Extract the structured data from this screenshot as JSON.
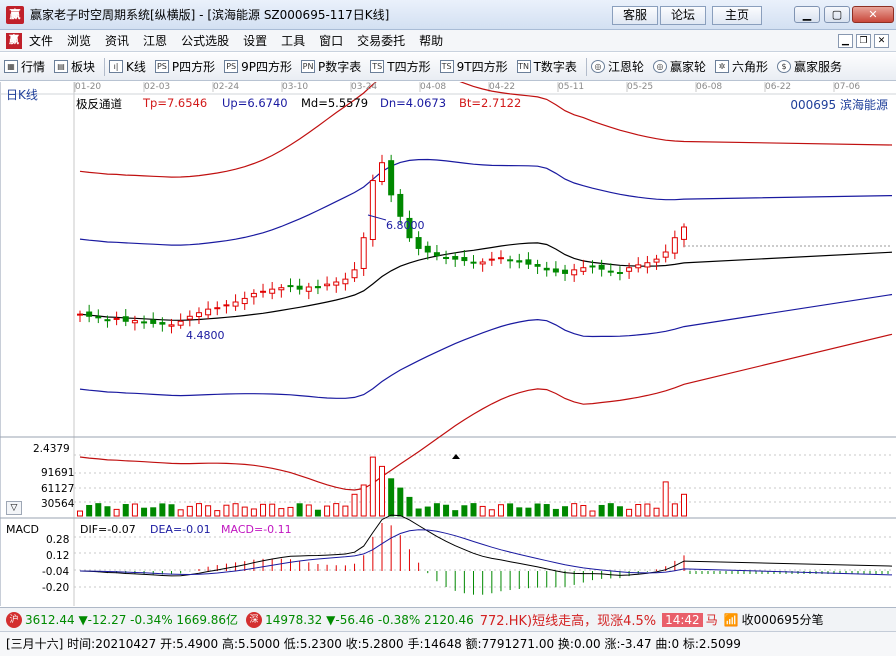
{
  "window": {
    "logo": "赢",
    "title": "赢家老子时空周期系统[纵横版] - [滨海能源  SZ000695-117日K线]",
    "buttons": [
      "客服",
      "论坛",
      "主页"
    ]
  },
  "menubar": {
    "logo": "赢",
    "items": [
      "文件",
      "浏览",
      "资讯",
      "江恩",
      "公式选股",
      "设置",
      "工具",
      "窗口",
      "交易委托",
      "帮助"
    ]
  },
  "toolbar": {
    "items": [
      {
        "icon": "grid-icon",
        "glyph": "▦",
        "label": "行情"
      },
      {
        "icon": "blocks-icon",
        "glyph": "▤",
        "label": "板块"
      },
      {
        "icon": "candlestick-icon",
        "glyph": "ı|",
        "label": "K线"
      },
      {
        "icon": "ps-icon",
        "glyph": "PS",
        "label": "P四方形"
      },
      {
        "icon": "9p-icon",
        "glyph": "PS",
        "label": "9P四方形"
      },
      {
        "icon": "pn-icon",
        "glyph": "PN",
        "label": "P数字表"
      },
      {
        "icon": "ts-icon",
        "glyph": "TS",
        "label": "T四方形"
      },
      {
        "icon": "9t-icon",
        "glyph": "TS",
        "label": "9T四方形"
      },
      {
        "icon": "tn-icon",
        "glyph": "TN",
        "label": "T数字表"
      },
      {
        "icon": "gann-wheel-icon",
        "glyph": "◎",
        "label": "江恩轮"
      },
      {
        "icon": "winner-wheel-icon",
        "glyph": "◎",
        "label": "赢家轮"
      },
      {
        "icon": "hexagon-icon",
        "glyph": "✲",
        "label": "六角形"
      },
      {
        "icon": "dollar-icon",
        "glyph": "$",
        "label": "赢家服务"
      }
    ]
  },
  "chart": {
    "period": "日K线",
    "dates": [
      "01-20",
      "02-03",
      "02-24",
      "03-10",
      "03-24",
      "04-08",
      "04-22",
      "05-11",
      "05-25",
      "06-08",
      "06-22",
      "07-06"
    ],
    "indicator": "极反通道",
    "tp": "Tp=7.6546",
    "up": "Up=6.6740",
    "md": "Md=5.5579",
    "dn": "Dn=4.0673",
    "bt": "Bt=2.7122",
    "stock": "000695  滨海能源",
    "high_label": "6.8000",
    "low_label": "4.4800",
    "volume_scale": [
      "2.4379",
      "91691",
      "61127",
      "30564"
    ],
    "macd": {
      "name": "MACD",
      "dif": "DIF=-0.07",
      "dea": "DEA=-0.01",
      "macd": "MACD=-0.11",
      "scale": [
        "0.28",
        "0.12",
        "-0.04",
        "-0.20"
      ]
    },
    "colors": {
      "up": "#e00000",
      "down": "#008800",
      "upper_band": "#c01010",
      "mid_band": "#1a1aa0",
      "middle": "#000000"
    }
  },
  "chart_data": {
    "type": "candlestick",
    "indicator": "极反通道",
    "close": [
      4.63,
      4.6,
      4.58,
      4.55,
      4.57,
      4.53,
      4.54,
      4.52,
      4.5,
      4.49,
      4.48,
      4.53,
      4.6,
      4.65,
      4.7,
      4.72,
      4.76,
      4.8,
      4.85,
      4.92,
      4.95,
      4.98,
      5.0,
      5.02,
      4.98,
      5.01,
      5.0,
      5.05,
      5.08,
      5.12,
      5.25,
      5.7,
      6.5,
      6.75,
      6.3,
      6.0,
      5.7,
      5.55,
      5.5,
      5.45,
      5.42,
      5.4,
      5.38,
      5.35,
      5.36,
      5.4,
      5.42,
      5.38,
      5.36,
      5.33,
      5.3,
      5.25,
      5.22,
      5.2,
      5.25,
      5.28,
      5.3,
      5.26,
      5.22,
      5.2,
      5.28,
      5.32,
      5.35,
      5.4,
      5.5,
      5.7,
      5.85
    ],
    "volume_max": 91691,
    "macd": {
      "dif": -0.07,
      "dea": -0.01,
      "macd": -0.11
    }
  },
  "status": {
    "sh_badge": "沪",
    "sh": "3612.44 ▼-12.27 -0.34% 1669.86亿",
    "sz_badge": "深",
    "sz": "14978.32 ▼-56.46 -0.38% 2120.46",
    "ticker": "772.HK)短线走高，现涨4.5%",
    "time": "14:42",
    "extra": "马",
    "receive": "收000695分笔"
  },
  "footer": {
    "line": "[三月十六] 时间:20210427 开:5.4900 高:5.5000 低:5.2300 收:5.2800 手:14648 额:7791271.00 换:0.00 涨:-3.47 曲:0 标:2.5099"
  }
}
